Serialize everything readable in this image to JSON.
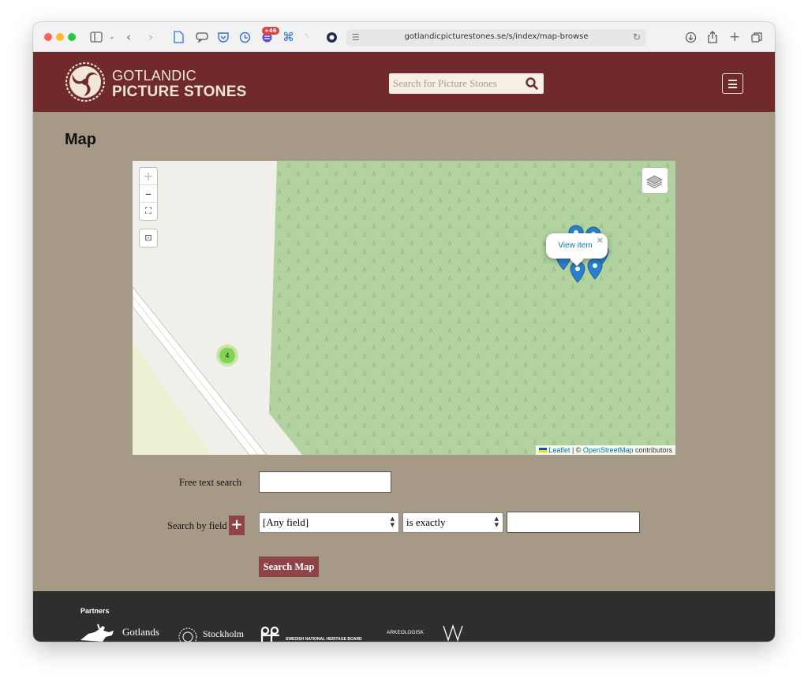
{
  "browser": {
    "url": "gotlandicpicturestones.se/s/index/map-browse",
    "extension_badge": "+46"
  },
  "site": {
    "logo_line1": "GOTLANDIC",
    "logo_line2": "PICTURE STONES",
    "search_placeholder": "Search for Picture Stones"
  },
  "page": {
    "title": "Map"
  },
  "map": {
    "zoom_in": "+",
    "zoom_out": "–",
    "fullscreen": "⛶",
    "locate": "⊡",
    "cluster_count": "4",
    "popup_link": "View item",
    "popup_close": "×",
    "attribution_leaflet": "Leaflet",
    "attribution_sep": " | © ",
    "attribution_osm": "OpenStreetMap",
    "attribution_tail": " contributors"
  },
  "form": {
    "free_text_label": "Free text search",
    "free_text_value": "",
    "search_by_field_label": "Search by field",
    "add_field": "+",
    "field_select": "[Any field]",
    "operator_select": "is exactly",
    "field_value": "",
    "submit": "Search Map"
  },
  "footer": {
    "partners_label": "Partners",
    "partner1": "Gotlands",
    "partner2": "Stockholm",
    "partner3": "SWEDISH NATIONAL HERITAGE BOARD",
    "partner4": "ARKEOLOGISK"
  }
}
